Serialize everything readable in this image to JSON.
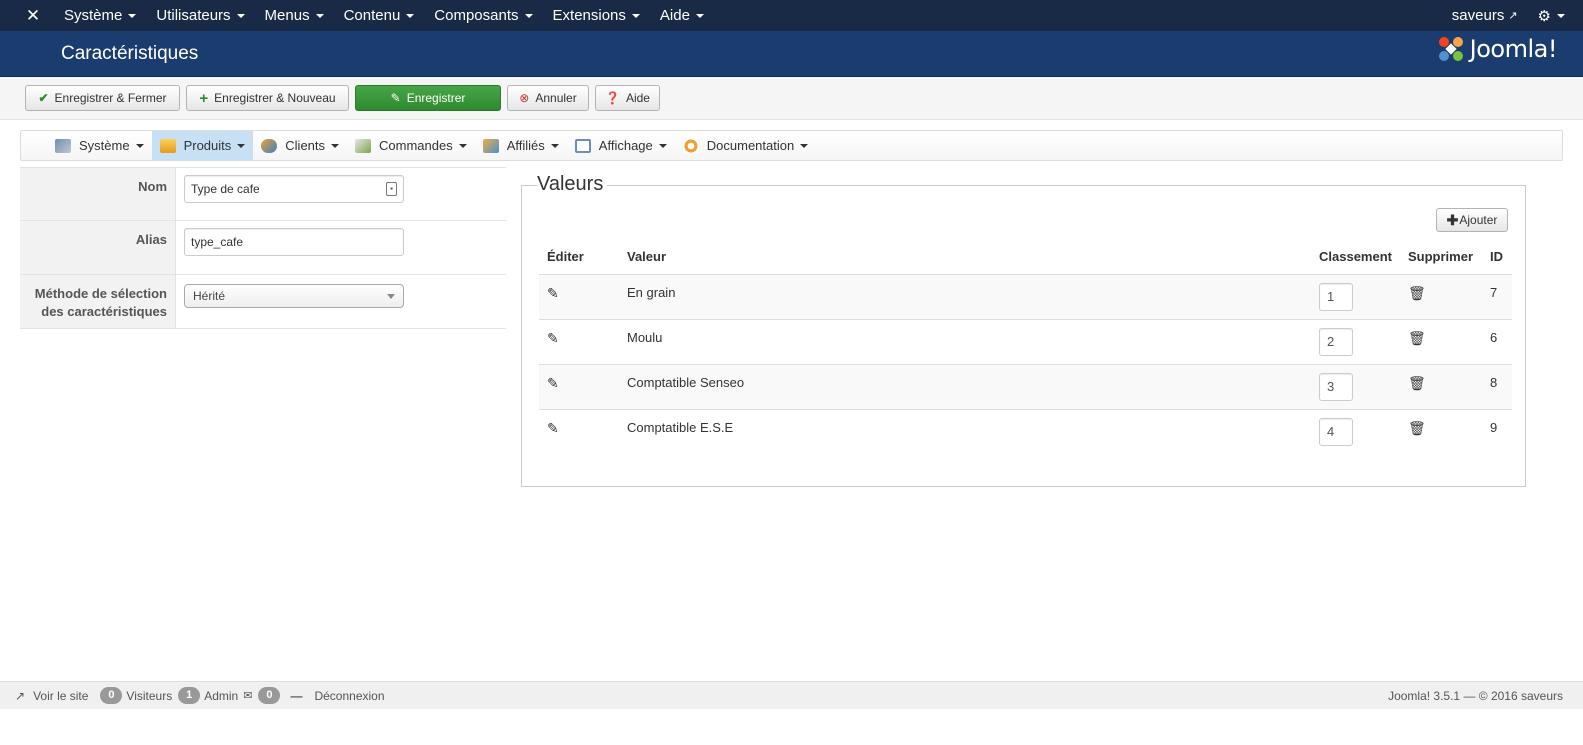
{
  "topbar": {
    "menu": [
      "Système",
      "Utilisateurs",
      "Menus",
      "Contenu",
      "Composants",
      "Extensions",
      "Aide"
    ],
    "user": "saveurs"
  },
  "header": {
    "title": "Caractéristiques",
    "logo": "Joomla!"
  },
  "toolbar": {
    "save_close": "Enregistrer & Fermer",
    "save_new": "Enregistrer & Nouveau",
    "save": "Enregistrer",
    "cancel": "Annuler",
    "help": "Aide"
  },
  "subnav": [
    "Système",
    "Produits",
    "Clients",
    "Commandes",
    "Affiliés",
    "Affichage",
    "Documentation"
  ],
  "form": {
    "name_label": "Nom",
    "name_value": "Type de cafe",
    "alias_label": "Alias",
    "alias_value": "type_cafe",
    "method_label": "Méthode de sélection des caractéristiques",
    "method_value": "Hérité"
  },
  "values": {
    "legend": "Valeurs",
    "add_button": "Ajouter",
    "columns": [
      "Éditer",
      "Valeur",
      "Classement",
      "Supprimer",
      "ID"
    ],
    "rows": [
      {
        "value": "En grain",
        "order": "1",
        "id": "7"
      },
      {
        "value": "Moulu",
        "order": "2",
        "id": "6"
      },
      {
        "value": "Comptatible Senseo",
        "order": "3",
        "id": "8"
      },
      {
        "value": "Comptatible E.S.E",
        "order": "4",
        "id": "9"
      }
    ]
  },
  "footer": {
    "view_site": "Voir le site",
    "visitors_count": "0",
    "visitors_label": "Visiteurs",
    "admin_count": "1",
    "admin_label": "Admin",
    "messages_count": "0",
    "logout": "Déconnexion",
    "version": "Joomla! 3.5.1  —  © 2016 saveurs"
  }
}
